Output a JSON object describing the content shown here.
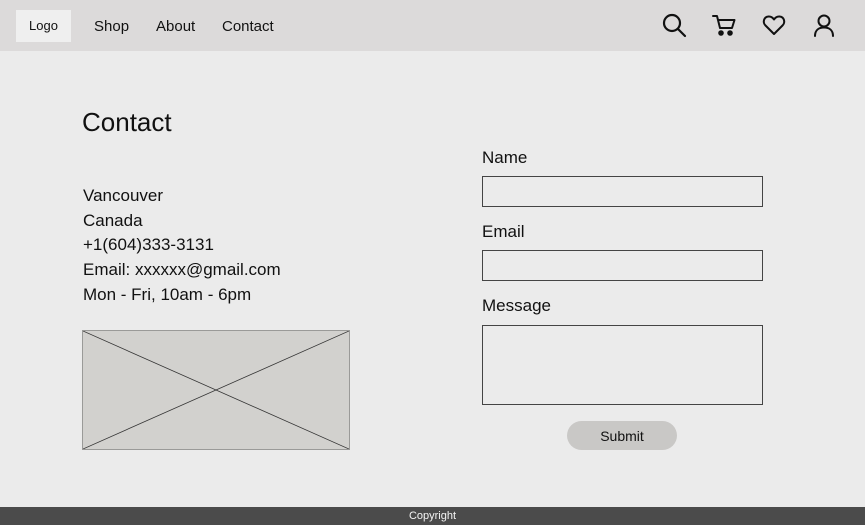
{
  "header": {
    "logo": "Logo",
    "nav": [
      "Shop",
      "About",
      "Contact"
    ],
    "icons": [
      "search-icon",
      "cart-icon",
      "heart-icon",
      "user-icon"
    ]
  },
  "contact": {
    "title": "Contact",
    "info": [
      "Vancouver",
      "Canada",
      "+1(604)333-3131",
      "Email: xxxxxx@gmail.com",
      "Mon - Fri, 10am - 6pm"
    ]
  },
  "form": {
    "name_label": "Name",
    "name_value": "",
    "email_label": "Email",
    "email_value": "",
    "message_label": "Message",
    "message_value": "",
    "submit_label": "Submit"
  },
  "footer": {
    "text": "Copyright"
  },
  "colors": {
    "header_bg": "#dcdada",
    "page_bg": "#ebebeb",
    "footer_bg": "#4b4b4b",
    "button_bg": "#c9c8c6",
    "image_placeholder": "#d2d1ce"
  }
}
